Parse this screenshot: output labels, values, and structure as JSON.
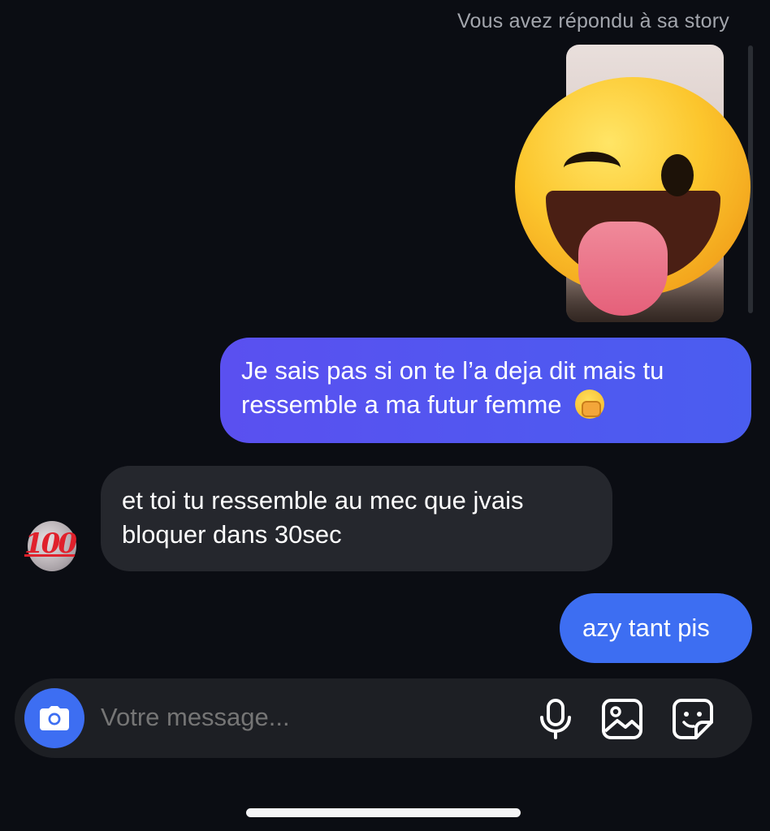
{
  "story_reply_note": "Vous avez répondu à sa story",
  "story": {
    "reaction_icon": "winking-face-with-tongue-icon"
  },
  "messages": [
    {
      "direction": "sent",
      "text": "Je sais pas si on te l’a deja dit mais tu ressemble a ma futur femme",
      "emoji_icon": "face-with-open-eyes-and-hand-over-mouth-icon"
    },
    {
      "direction": "received",
      "text": "et toi tu ressemble au mec que jvais bloquer dans 30sec",
      "avatar_badge": "100"
    },
    {
      "direction": "sent",
      "text": "azy tant pis"
    }
  ],
  "composer": {
    "placeholder": "Votre message...",
    "icons": [
      "camera-icon",
      "microphone-icon",
      "gallery-icon",
      "sticker-icon"
    ]
  },
  "colors": {
    "background": "#0b0d13",
    "sent_bubble": "#4a5df0",
    "received_bubble": "#25272d",
    "accent": "#3d6ef2"
  }
}
